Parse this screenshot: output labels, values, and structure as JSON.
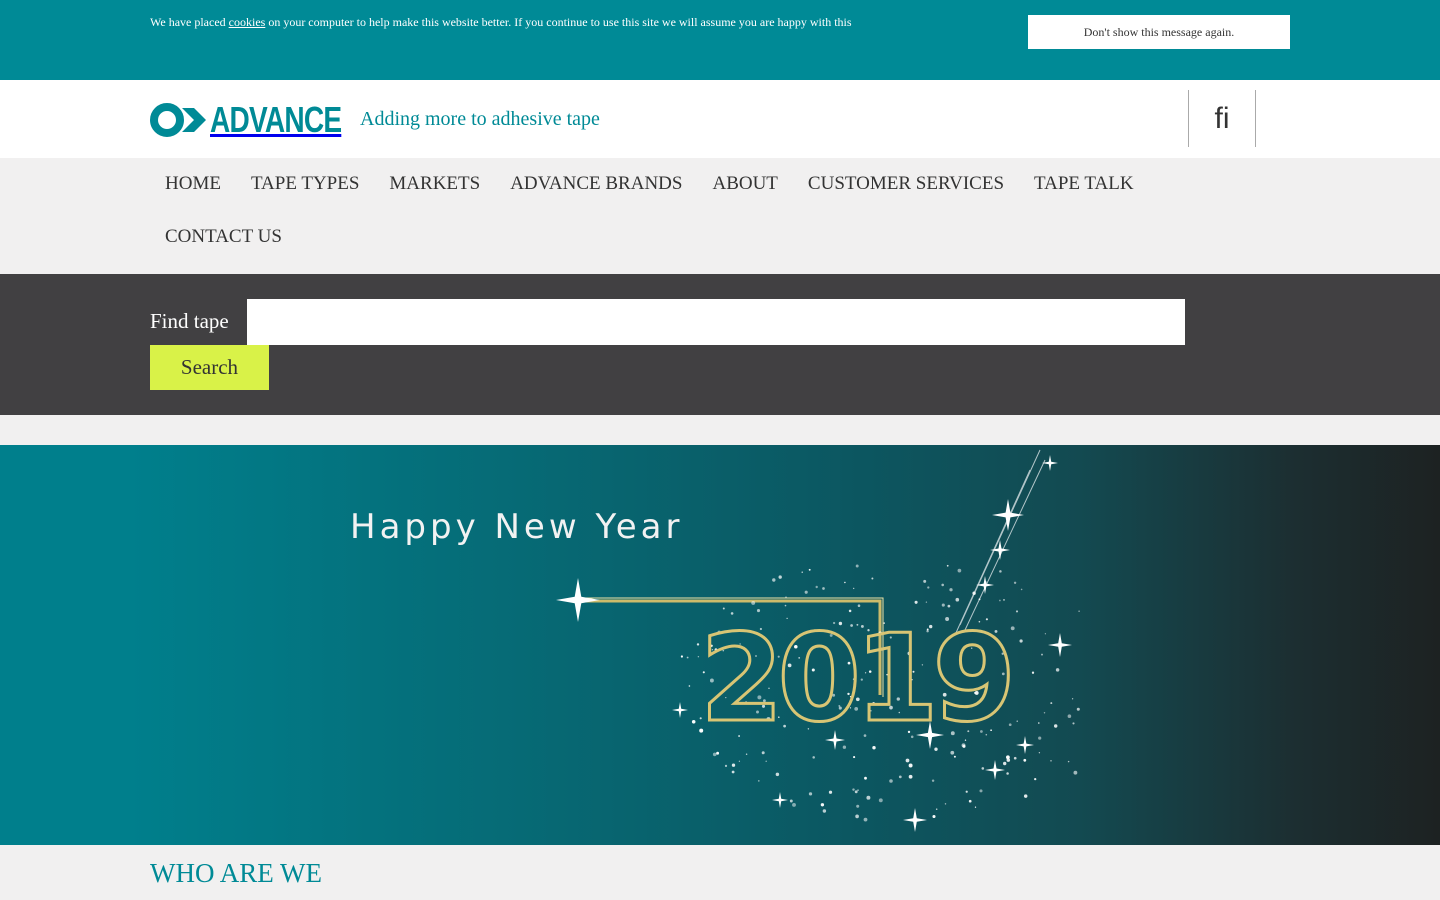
{
  "cookie_bar": {
    "text_before": "We have placed ",
    "link": "cookies",
    "text_after": " on your computer to help make this website better. If you continue to use this site we will assume you are happy with this",
    "dismiss_label": "Don't show this message again."
  },
  "header": {
    "logo_text": "ADVANCE",
    "tagline": "Adding more to adhesive tape",
    "language": "fi"
  },
  "nav": {
    "items": [
      "HOME",
      "TAPE TYPES",
      "MARKETS",
      "ADVANCE BRANDS",
      "ABOUT",
      "CUSTOMER SERVICES",
      "TAPE TALK",
      "CONTACT US"
    ]
  },
  "search": {
    "label": "Find tape",
    "value": "",
    "button": "Search"
  },
  "banner": {
    "headline": "Happy New Year",
    "year": "2019"
  },
  "sections": {
    "who_title": "WHO ARE WE"
  },
  "colors": {
    "brand_teal": "#008a96",
    "search_band": "#414042",
    "search_button": "#d9f248"
  }
}
